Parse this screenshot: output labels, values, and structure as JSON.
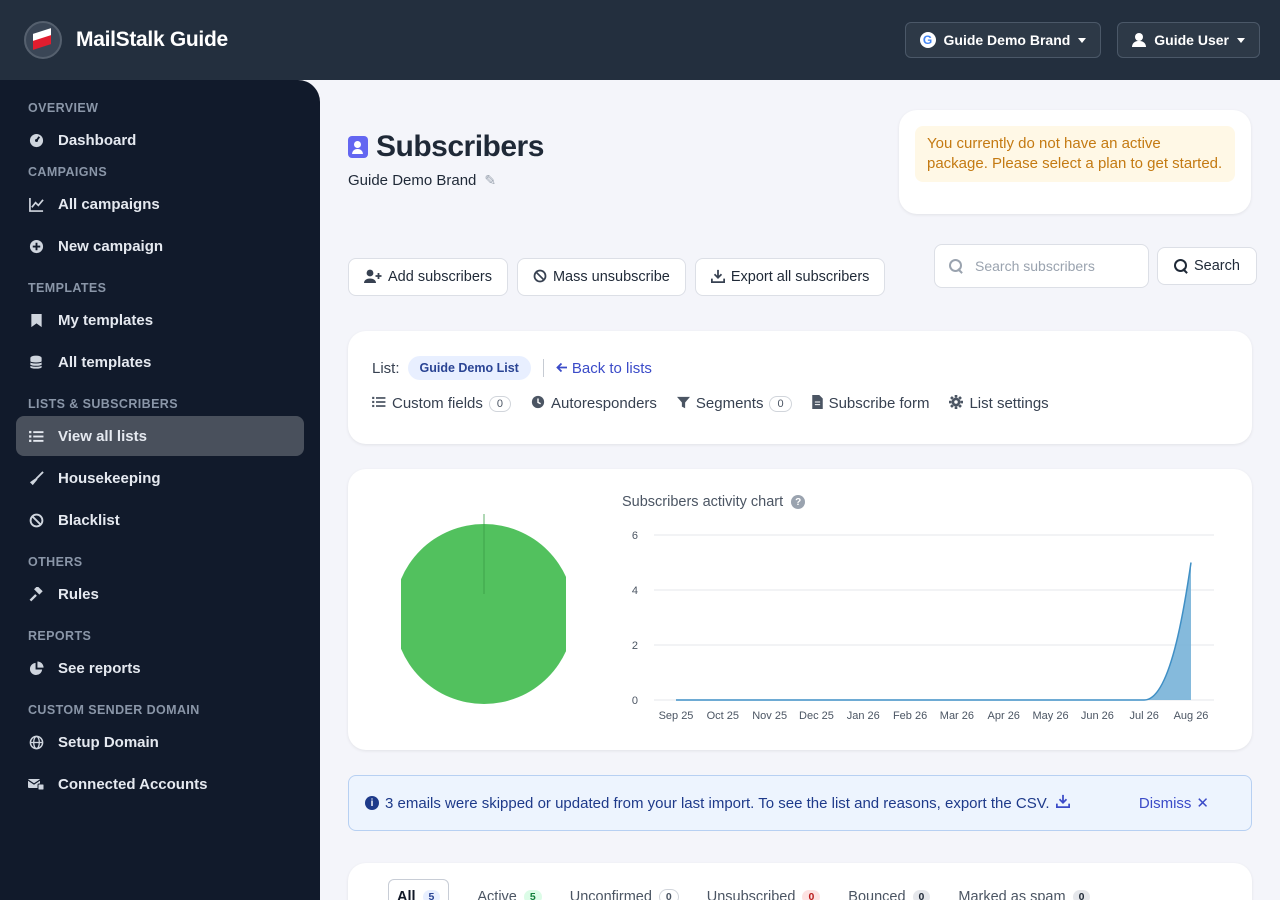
{
  "app": {
    "name": "MailStalk Guide"
  },
  "topbar": {
    "brand_button": "Guide Demo Brand",
    "user_button": "Guide User"
  },
  "sidebar": {
    "sections": {
      "overview": "OVERVIEW",
      "campaigns": "CAMPAIGNS",
      "templates": "TEMPLATES",
      "lists": "LISTS & SUBSCRIBERS",
      "others": "OTHERS",
      "reports": "REPORTS",
      "domain": "CUSTOM SENDER DOMAIN"
    },
    "items": {
      "dashboard": "Dashboard",
      "all_campaigns": "All campaigns",
      "new_campaign": "New campaign",
      "my_templates": "My templates",
      "all_templates": "All templates",
      "view_all_lists": "View all lists",
      "housekeeping": "Housekeeping",
      "blacklist": "Blacklist",
      "rules": "Rules",
      "see_reports": "See reports",
      "setup_domain": "Setup Domain",
      "connected_accounts": "Connected Accounts"
    }
  },
  "page": {
    "title": "Subscribers",
    "brand": "Guide Demo Brand"
  },
  "notice": {
    "text": "You currently do not have an active package. Please select a plan to get started."
  },
  "actions": {
    "add": "Add subscribers",
    "mass_unsub": "Mass unsubscribe",
    "export": "Export all subscribers"
  },
  "search": {
    "placeholder": "Search subscribers",
    "button": "Search"
  },
  "list": {
    "label": "List:",
    "name": "Guide Demo List",
    "back": "Back to lists",
    "links": {
      "custom_fields": "Custom fields",
      "custom_fields_count": "0",
      "autoresponders": "Autoresponders",
      "segments": "Segments",
      "segments_count": "0",
      "subscribe_form": "Subscribe form",
      "list_settings": "List settings"
    }
  },
  "info": {
    "text": "3 emails were skipped or updated from your last import. To see the list and reasons, export the CSV.",
    "dismiss": "Dismiss"
  },
  "tabs": [
    {
      "label": "All",
      "count": "5"
    },
    {
      "label": "Active",
      "count": "5"
    },
    {
      "label": "Unconfirmed",
      "count": "0"
    },
    {
      "label": "Unsubscribed",
      "count": "0"
    },
    {
      "label": "Bounced",
      "count": "0"
    },
    {
      "label": "Marked as spam",
      "count": "0"
    }
  ],
  "colors": {
    "accent": "#3b4bc8",
    "pie_active": "#52c15e",
    "area_fill": "#78b2d8",
    "notice_text": "#c47a12"
  },
  "chart_data": [
    {
      "type": "pie",
      "slices": [
        {
          "value": 100,
          "color": "#52c15e"
        }
      ]
    },
    {
      "type": "area",
      "title": "Subscribers activity chart",
      "categories": [
        "Sep 25",
        "Oct 25",
        "Nov 25",
        "Dec 25",
        "Jan 26",
        "Feb 26",
        "Mar 26",
        "Apr 26",
        "May 26",
        "Jun 26",
        "Jul 26",
        "Aug 26"
      ],
      "values": [
        0,
        0,
        0,
        0,
        0,
        0,
        0,
        0,
        0,
        0,
        0,
        5
      ],
      "ylim": [
        0,
        6
      ],
      "yticks": [
        "0",
        "2",
        "4",
        "6"
      ],
      "grid": true
    }
  ]
}
